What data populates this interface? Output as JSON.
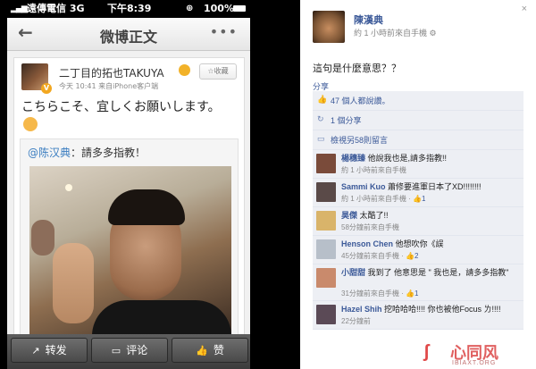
{
  "phone": {
    "status": {
      "signal": "▂▄▆",
      "carrier": "遠傳電信  3G",
      "time": "下午8:39",
      "lock": "⊕",
      "battery": "100%"
    },
    "nav": {
      "back_icon": "back-arrow-icon",
      "back": "←",
      "title": "微博正文",
      "more": "•••"
    },
    "post": {
      "username": "二丁目的拓也TAKUYA",
      "verified": "V",
      "meta": "今天 10:41  来自iPhone客户端",
      "fav_label": "☆收藏",
      "text": "こちらこそ、宜しくお願いします。",
      "quote_mention": "@陈汉典",
      "quote_text": "：請多多指教！"
    },
    "toolbar": {
      "forward": {
        "icon": "↗",
        "label": "转发"
      },
      "comment": {
        "icon": "▭",
        "label": "评论"
      },
      "like": {
        "icon": "👍",
        "label": "赞"
      }
    }
  },
  "fb": {
    "close": "×",
    "name": "陳漢典",
    "meta": "約 1 小時前來自手機 ⚙",
    "text": "這句是什麼意思？？",
    "share": "分享",
    "likes": "47 個人都說讚。",
    "shares": "1 個分享",
    "more_comments": "檢視另58則留言",
    "comments": [
      {
        "name": "楊穗臻",
        "text": "他說我也是,請多指教!!",
        "meta": "約 1 小時前來自手機",
        "like": "",
        "avatar_color": "#7a4b3a"
      },
      {
        "name": "Sammi Kuo",
        "text": "蕭修要進軍日本了XD!!!!!!!!",
        "meta": "約 1 小時前來自手機 ·",
        "like": "👍1",
        "avatar_color": "#5a4a48"
      },
      {
        "name": "昊傑",
        "text": "太酷了!!",
        "meta": "58分鐘前來自手機",
        "like": "",
        "avatar_color": "#d9b46a"
      },
      {
        "name": "Henson Chen",
        "text": "他想吹你《誤",
        "meta": "45分鐘前來自手機 ·",
        "like": "👍2",
        "avatar_color": "#b7bfc9"
      },
      {
        "name": "小甜甜",
        "text": "我到了 他意思是 \" 我也是，請多多指教\"",
        "meta": "31分鐘前來自手機 ·",
        "like": "👍1",
        "avatar_color": "#c98a6c"
      },
      {
        "name": "Hazel Shih",
        "text": "挖哈哈哈!!!! 你也被他Focus ㄌ!!!!",
        "meta": "22分鐘前",
        "like": "",
        "avatar_color": "#5b4a56"
      }
    ]
  },
  "watermark": {
    "cn": "心同风",
    "url": "IBIAXT.ORG"
  }
}
